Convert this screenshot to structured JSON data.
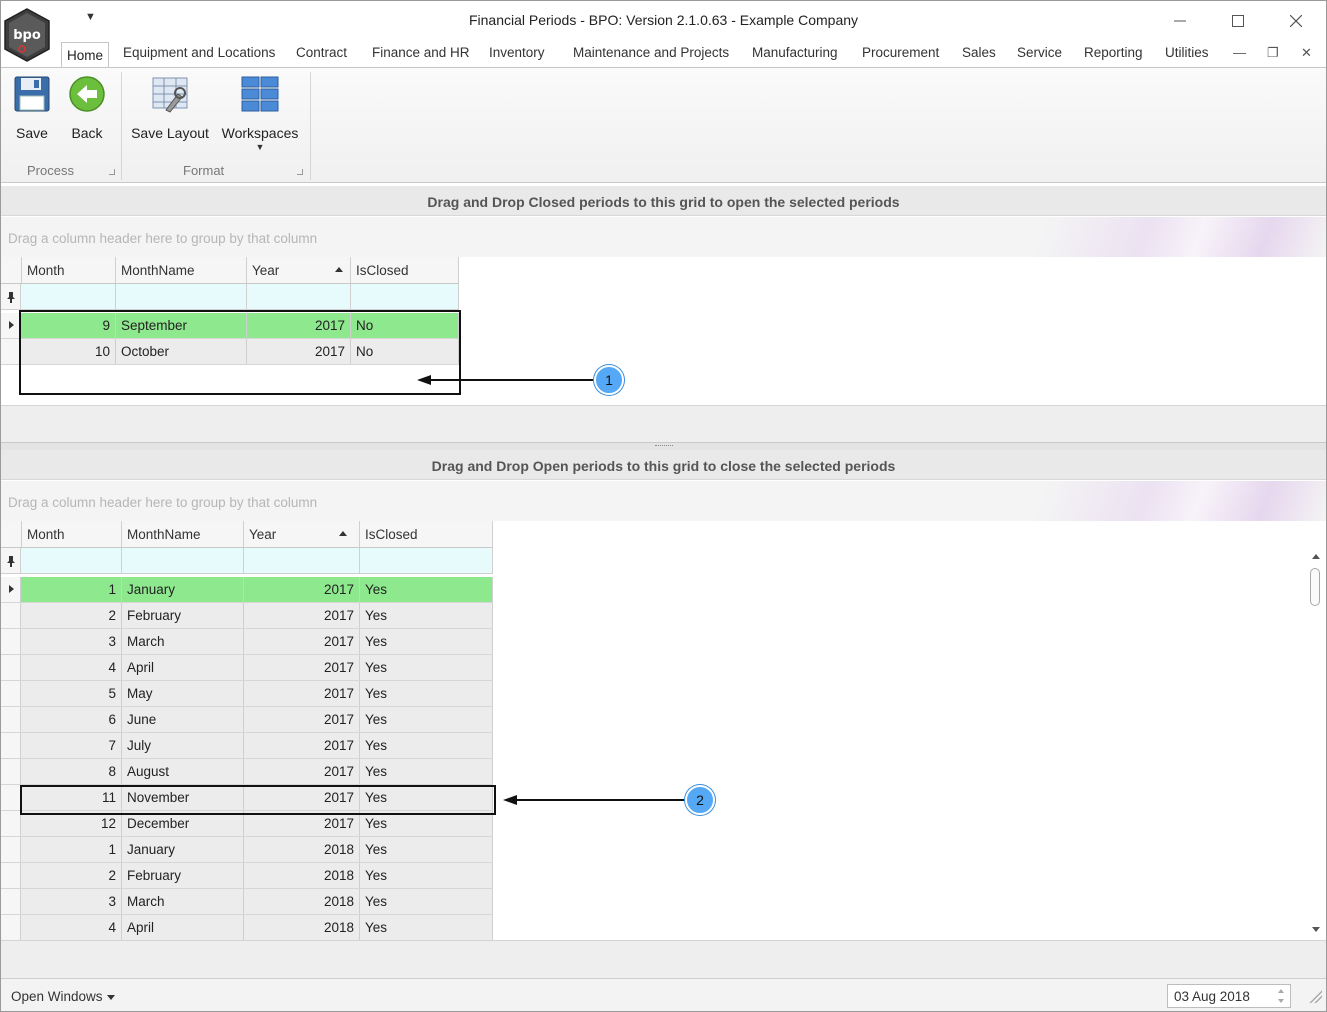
{
  "window": {
    "title": "Financial Periods - BPO: Version 2.1.0.63 - Example Company"
  },
  "logo": {
    "text": "bpo"
  },
  "tabs": [
    {
      "label": "Home"
    },
    {
      "label": "Equipment and Locations"
    },
    {
      "label": "Contract"
    },
    {
      "label": "Finance and HR"
    },
    {
      "label": "Inventory"
    },
    {
      "label": "Maintenance and Projects"
    },
    {
      "label": "Manufacturing"
    },
    {
      "label": "Procurement"
    },
    {
      "label": "Sales"
    },
    {
      "label": "Service"
    },
    {
      "label": "Reporting"
    },
    {
      "label": "Utilities"
    }
  ],
  "ribbon": {
    "process": {
      "label": "Process",
      "save": "Save",
      "back": "Back"
    },
    "format": {
      "label": "Format",
      "save_layout": "Save Layout",
      "workspaces": "Workspaces"
    }
  },
  "top_grid": {
    "caption": "Drag and Drop Closed periods to this grid to open the selected periods",
    "group_hint": "Drag a column header here to group by that column",
    "columns": [
      "Month",
      "MonthName",
      "Year",
      "IsClosed"
    ],
    "rows": [
      {
        "month": "9",
        "name": "September",
        "year": "2017",
        "closed": "No"
      },
      {
        "month": "10",
        "name": "October",
        "year": "2017",
        "closed": "No"
      }
    ]
  },
  "bottom_grid": {
    "caption": "Drag and Drop Open periods to this grid to close the selected periods",
    "group_hint": "Drag a column header here to group by that column",
    "columns": [
      "Month",
      "MonthName",
      "Year",
      "IsClosed"
    ],
    "rows": [
      {
        "month": "1",
        "name": "January",
        "year": "2017",
        "closed": "Yes"
      },
      {
        "month": "2",
        "name": "February",
        "year": "2017",
        "closed": "Yes"
      },
      {
        "month": "3",
        "name": "March",
        "year": "2017",
        "closed": "Yes"
      },
      {
        "month": "4",
        "name": "April",
        "year": "2017",
        "closed": "Yes"
      },
      {
        "month": "5",
        "name": "May",
        "year": "2017",
        "closed": "Yes"
      },
      {
        "month": "6",
        "name": "June",
        "year": "2017",
        "closed": "Yes"
      },
      {
        "month": "7",
        "name": "July",
        "year": "2017",
        "closed": "Yes"
      },
      {
        "month": "8",
        "name": "August",
        "year": "2017",
        "closed": "Yes"
      },
      {
        "month": "11",
        "name": "November",
        "year": "2017",
        "closed": "Yes"
      },
      {
        "month": "12",
        "name": "December",
        "year": "2017",
        "closed": "Yes"
      },
      {
        "month": "1",
        "name": "January",
        "year": "2018",
        "closed": "Yes"
      },
      {
        "month": "2",
        "name": "February",
        "year": "2018",
        "closed": "Yes"
      },
      {
        "month": "3",
        "name": "March",
        "year": "2018",
        "closed": "Yes"
      },
      {
        "month": "4",
        "name": "April",
        "year": "2018",
        "closed": "Yes"
      }
    ]
  },
  "callouts": {
    "one": "1",
    "two": "2"
  },
  "statusbar": {
    "open_windows": "Open Windows",
    "date": "03 Aug 2018"
  },
  "colors": {
    "selected_row": "#8ee98e",
    "filter_row": "#e7fbfd",
    "callout": "#55a8f5"
  }
}
